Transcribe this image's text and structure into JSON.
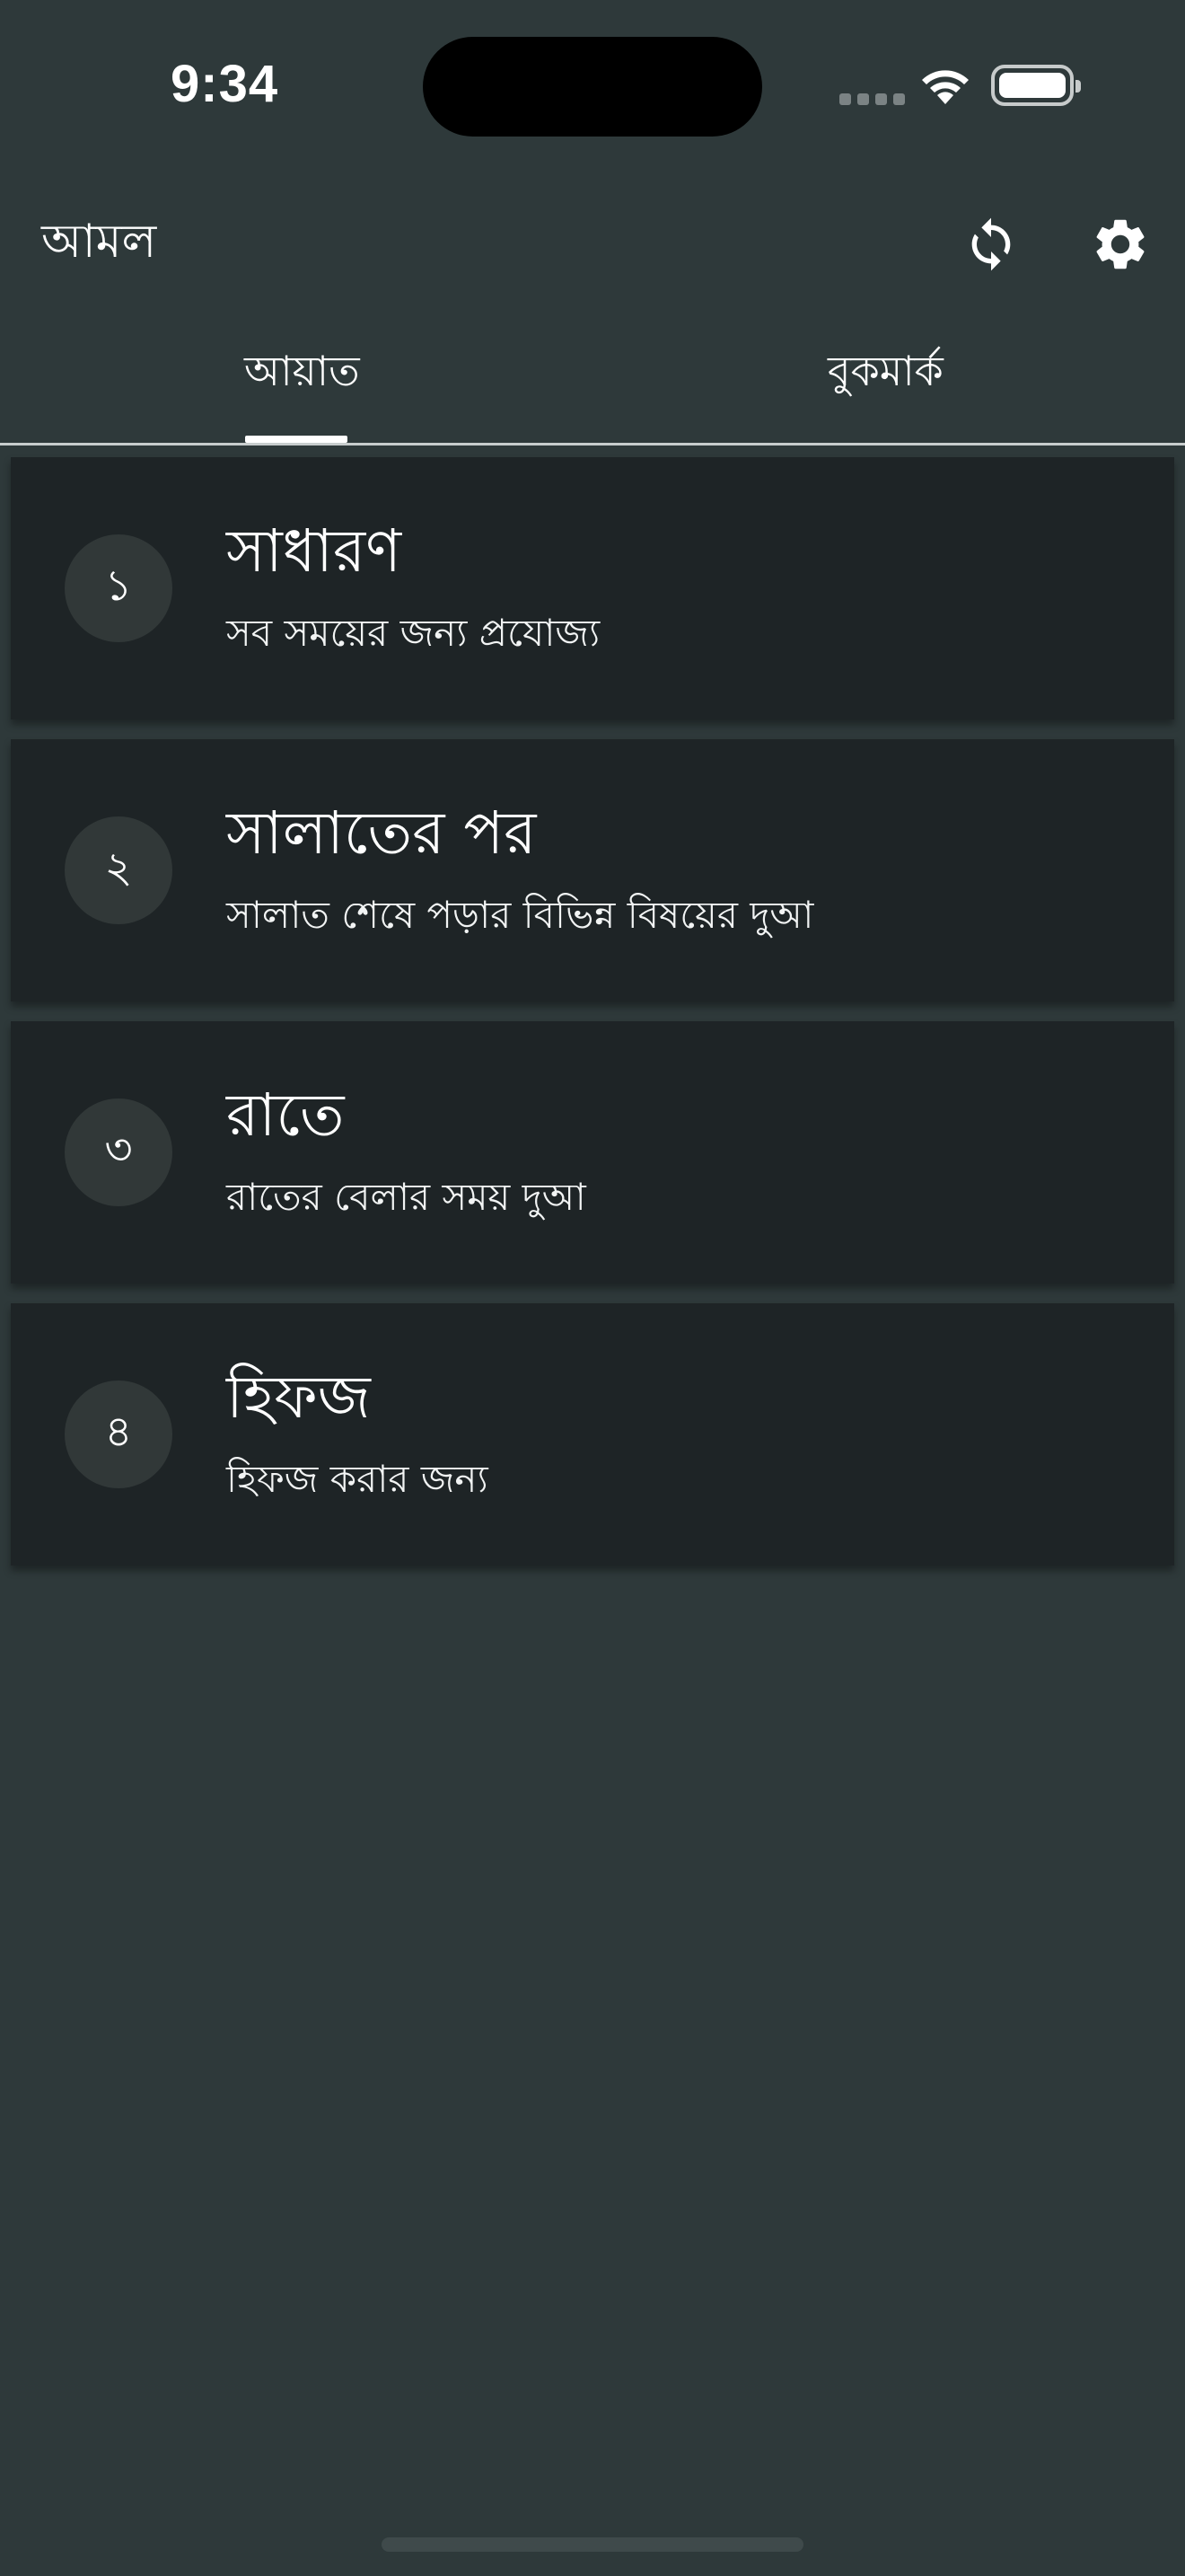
{
  "status_bar": {
    "time": "9:34"
  },
  "app_bar": {
    "title": "আমল",
    "icons": {
      "sync": "sync-icon",
      "settings": "gear-icon"
    }
  },
  "tabs": [
    {
      "label": "আয়াত",
      "selected": true
    },
    {
      "label": "বুকমার্ক",
      "selected": false
    }
  ],
  "categories": [
    {
      "number": "১",
      "title": "সাধারণ",
      "subtitle": "সব সময়ের জন্য প্রযোজ্য"
    },
    {
      "number": "২",
      "title": "সালাতের পর",
      "subtitle": "সালাত শেষে পড়ার বিভিন্ন বিষয়ের দুআ"
    },
    {
      "number": "৩",
      "title": "রাতে",
      "subtitle": "রাতের বেলার সময় দুআ"
    },
    {
      "number": "৪",
      "title": "হিফজ",
      "subtitle": "হিফজ করার জন্য"
    }
  ],
  "colors": {
    "background": "#2e393a",
    "card": "#1e2426",
    "number_circle": "#313838",
    "text": "#ffffff"
  }
}
